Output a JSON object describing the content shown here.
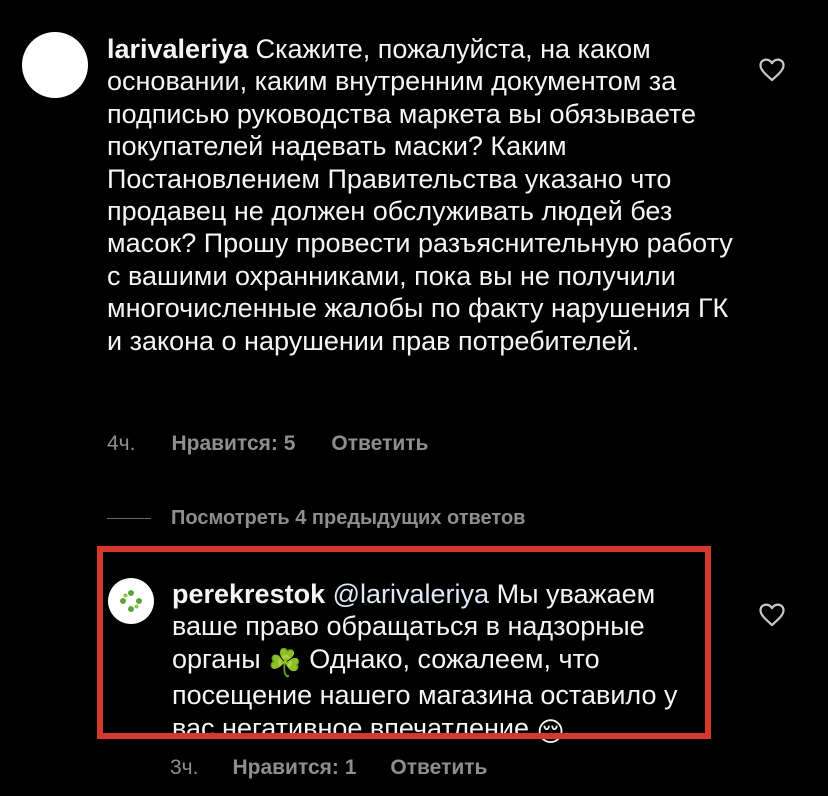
{
  "comment": {
    "username": "larivaleriya",
    "text": "Скажите, пожалуйста, на каком основании, каким внутренним документом за подписью руководства маркета вы обязываете покупателей надевать маски? Каким Постановлением Правительства указано что продавец не должен обслуживать людей без масок? Прошу провести разъяснительную работу с вашими охранниками, пока вы не получили многочисленные жалобы по факту нарушения ГК и закона о нарушении прав потребителей.",
    "time": "4ч.",
    "likes": "Нравится: 5",
    "reply_label": "Ответить",
    "like_icon": "heart-outline-icon"
  },
  "view_previous_replies": "Посмотреть 4 предыдущих ответов",
  "reply": {
    "username": "perekrestok",
    "mention": "@larivaleriya",
    "text_part1": "Мы уважаем ваше право обращаться в надзорные органы",
    "emoji1": "☘️",
    "text_part2": "Однако, сожалеем, что посещение нашего магазина оставило у вас негативное впечатление",
    "emoji2": "😔",
    "time": "3ч.",
    "likes": "Нравится: 1",
    "reply_label": "Ответить",
    "like_icon": "heart-outline-icon",
    "avatar_icon": "perekrestok-logo-icon"
  },
  "colors": {
    "background": "#000000",
    "text": "#f5f5f5",
    "muted": "#8e8e8e",
    "highlight_border": "#d5392b",
    "brand_green": "#5aa53a"
  }
}
